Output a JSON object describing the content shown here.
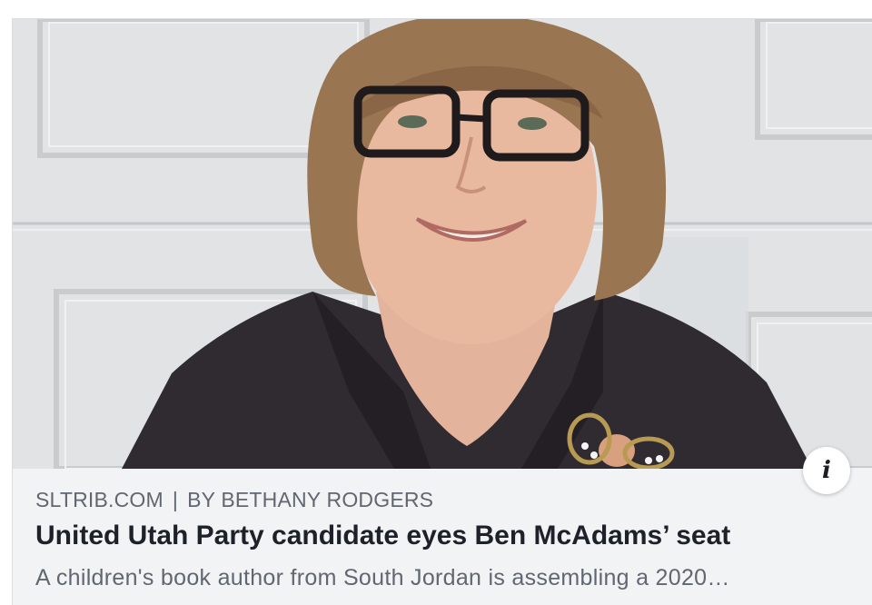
{
  "link_preview": {
    "source_domain": "SLTRIB.COM",
    "separator": "|",
    "byline": "BY BETHANY RODGERS",
    "headline": "United Utah Party candidate eyes Ben McAdams’ seat",
    "description": "A children's book author from South Jordan is assembling a 2020…",
    "info_icon": "info-icon",
    "info_glyph": "i"
  },
  "colors": {
    "card_background": "#f2f3f5",
    "meta_text": "#606770",
    "headline_text": "#1d2129",
    "border": "#dadde1"
  }
}
